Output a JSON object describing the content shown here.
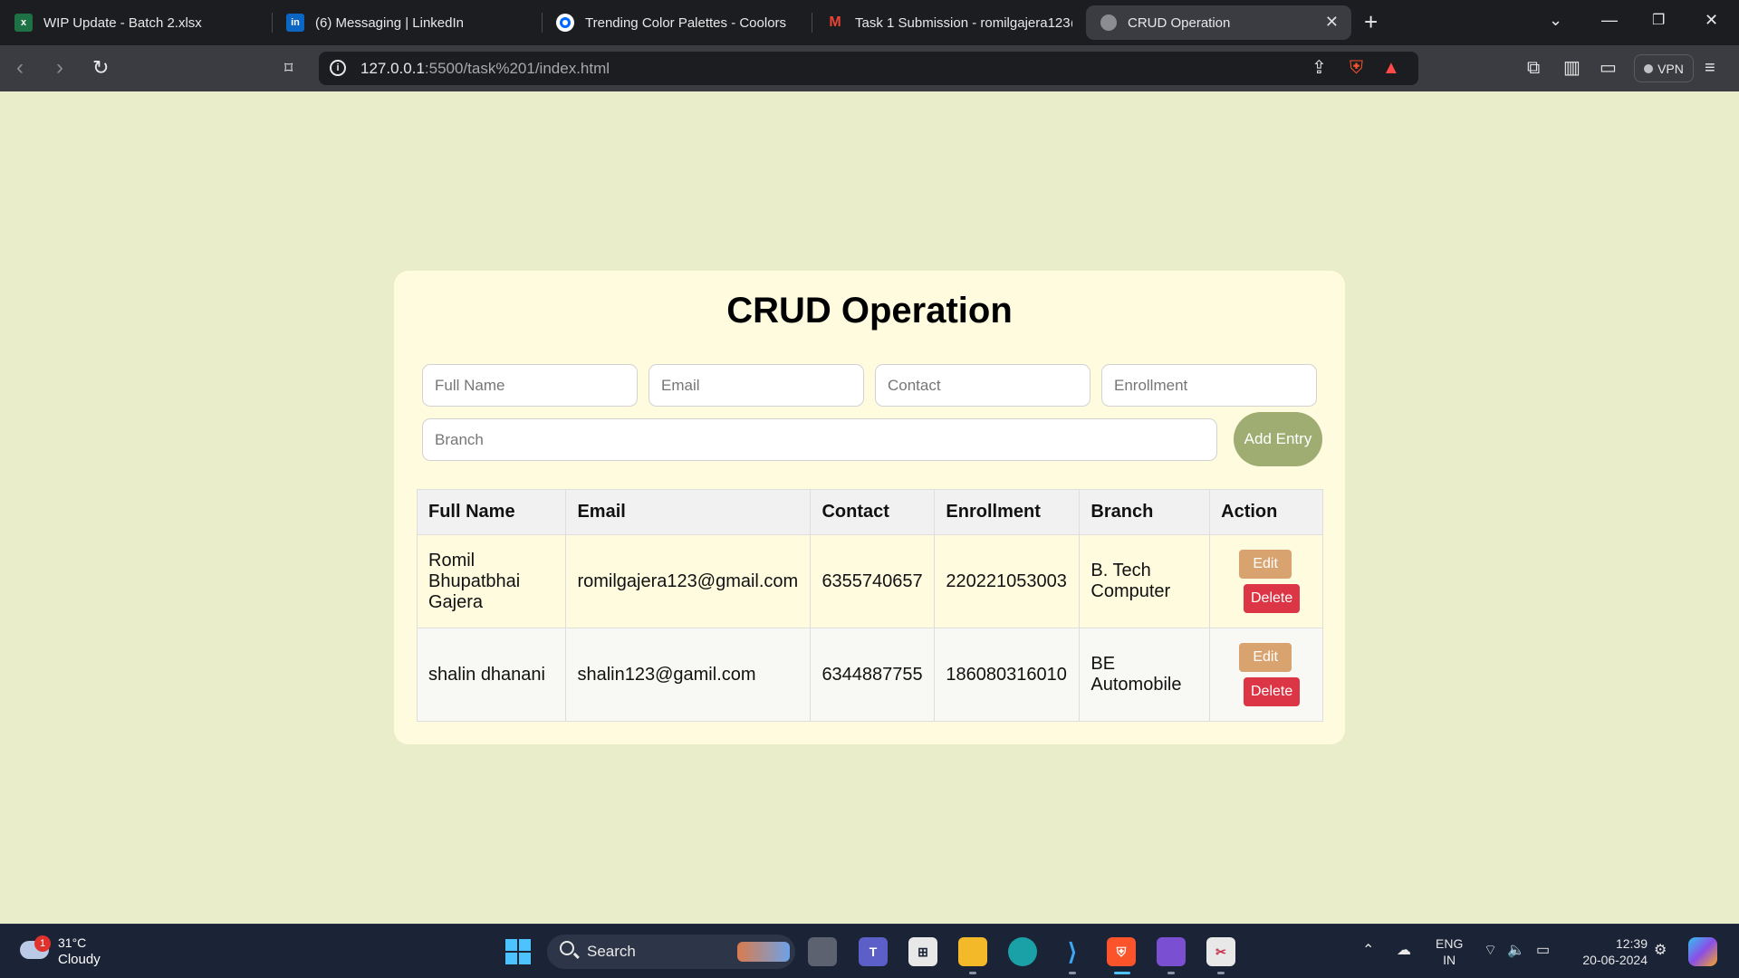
{
  "browser": {
    "tabs": [
      {
        "icon": "excel-icon",
        "title": "WIP Update - Batch 2.xlsx"
      },
      {
        "icon": "linkedin-icon",
        "title": "(6) Messaging | LinkedIn"
      },
      {
        "icon": "coolors-icon",
        "title": "Trending Color Palettes - Coolors"
      },
      {
        "icon": "gmail-icon",
        "title": "Task 1 Submission - romilgajera123@"
      },
      {
        "icon": "globe-icon",
        "title": "CRUD Operation"
      }
    ],
    "url_host": "127.0.0.1",
    "url_rest": ":5500/task%201/index.html",
    "vpn_label": "VPN"
  },
  "page": {
    "title": "CRUD Operation",
    "form": {
      "full_name_placeholder": "Full Name",
      "email_placeholder": "Email",
      "contact_placeholder": "Contact",
      "enrollment_placeholder": "Enrollment",
      "branch_placeholder": "Branch",
      "add_label": "Add Entry"
    },
    "table": {
      "headers": [
        "Full Name",
        "Email",
        "Contact",
        "Enrollment",
        "Branch",
        "Action"
      ],
      "rows": [
        {
          "name": "Romil Bhupatbhai Gajera",
          "email": "romilgajera123@gmail.com",
          "contact": "6355740657",
          "enrollment": "220221053003",
          "branch": "B. Tech Computer"
        },
        {
          "name": "shalin dhanani",
          "email": "shalin123@gamil.com",
          "contact": "6344887755",
          "enrollment": "186080316010",
          "branch": "BE Automobile"
        }
      ],
      "edit_label": "Edit",
      "delete_label": "Delete"
    }
  },
  "taskbar": {
    "weather_badge": "1",
    "temperature": "31°C",
    "condition": "Cloudy",
    "search_label": "Search",
    "lang_top": "ENG",
    "lang_bottom": "IN",
    "time": "12:39",
    "date": "20-06-2024"
  },
  "colors": {
    "page_bg": "#e9edca",
    "card_bg": "#fefbde",
    "add_button": "#9fad73",
    "edit_button": "#d9a36f",
    "delete_button": "#dc3545"
  }
}
